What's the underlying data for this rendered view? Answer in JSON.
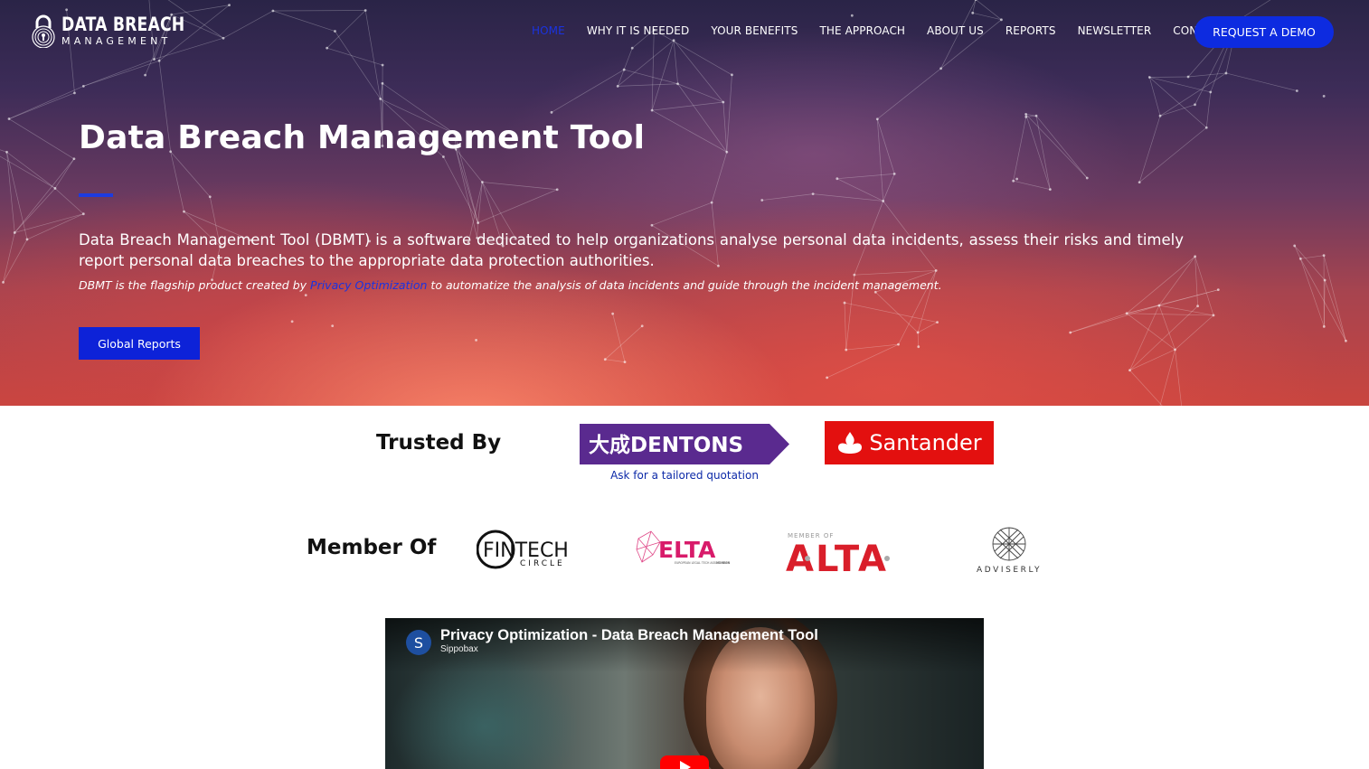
{
  "logo": {
    "line1": "DATA BREACH",
    "line2": "MANAGEMENT"
  },
  "nav": {
    "items": [
      "HOME",
      "WHY IT IS NEEDED",
      "YOUR BENEFITS",
      "THE APPROACH",
      "ABOUT US",
      "REPORTS",
      "NEWSLETTER",
      "CONTACT"
    ],
    "active": "HOME",
    "cta": "REQUEST A DEMO"
  },
  "hero": {
    "title": "Data Breach Management Tool",
    "intro": "Data Breach Management Tool (DBMT) is a software dedicated to help organizations analyse personal data incidents, assess their risks and timely report personal data breaches to the appropriate data protection authorities.",
    "sub_prefix": "DBMT is the flagship product created by ",
    "sub_link": "Privacy Optimization",
    "sub_suffix": " to automatize the analysis of data incidents and guide through the incident management.",
    "button": "Global Reports"
  },
  "trusted": {
    "label": "Trusted By",
    "dentons": "大成DENTONS",
    "quote_link": "Ask for a tailored quotation",
    "santander": "Santander"
  },
  "member": {
    "label": "Member Of",
    "fintech_main": "FINTECH",
    "fintech_sub": "CIRCLE",
    "elta_main": "ELTA",
    "elta_sub": "EUROPEAN LEGAL TECH ASSOCIATION",
    "elta_member": "MEMBER",
    "alta_top": "MEMBER OF",
    "alta_main": "ALTA",
    "adviserly": "ADVISERLY"
  },
  "video": {
    "avatar_letter": "S",
    "title": "Privacy Optimization - Data Breach Management Tool",
    "channel": "Sippobax"
  },
  "colors": {
    "accent_blue": "#0d2be0",
    "link_blue": "#1a33e0",
    "dentons_purple": "#5a2a8f",
    "santander_red": "#e3100f",
    "alta_red": "#d91e2a",
    "elta_pink": "#d81b6a"
  }
}
